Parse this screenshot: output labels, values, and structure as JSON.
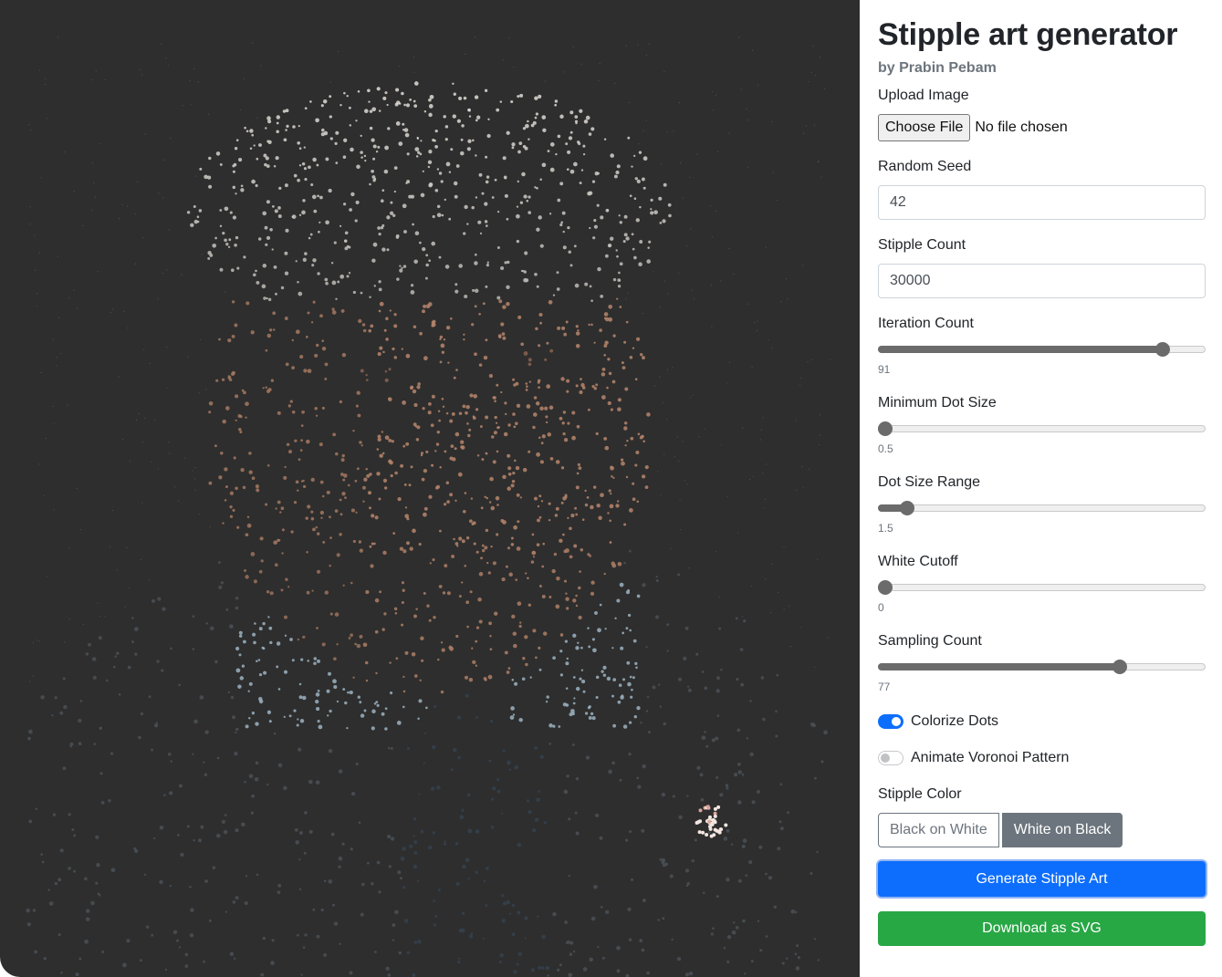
{
  "canvas": {
    "background": "#2e2e2e",
    "description_icon": "stipple-portrait-image"
  },
  "panel": {
    "title": "Stipple art generator",
    "subtitle": "by Prabin Pebam",
    "upload": {
      "label": "Upload Image",
      "button": "Choose File",
      "status": "No file chosen"
    },
    "seed": {
      "label": "Random Seed",
      "value": "42"
    },
    "count": {
      "label": "Stipple Count",
      "value": "30000"
    },
    "sliders": {
      "iteration": {
        "label": "Iteration Count",
        "value": "91",
        "fraction": 0.885
      },
      "min_dot": {
        "label": "Minimum Dot Size",
        "value": "0.5",
        "fraction": 0.0
      },
      "dot_range": {
        "label": "Dot Size Range",
        "value": "1.5",
        "fraction": 0.07
      },
      "white_cutoff": {
        "label": "White Cutoff",
        "value": "0",
        "fraction": 0.0
      },
      "sampling": {
        "label": "Sampling Count",
        "value": "77",
        "fraction": 0.75
      }
    },
    "colorize": {
      "label": "Colorize Dots",
      "on": true
    },
    "animate": {
      "label": "Animate Voronoi Pattern",
      "on": false
    },
    "stipple_color": {
      "label": "Stipple Color",
      "options": [
        "Black on White",
        "White on Black"
      ],
      "selected": "White on Black"
    },
    "generate_label": "Generate Stipple Art",
    "download_label": "Download as SVG"
  },
  "colors": {
    "primary": "#0d6efd",
    "success": "#28a745",
    "secondary": "#6c757d",
    "slider": "#6b6b6b"
  }
}
